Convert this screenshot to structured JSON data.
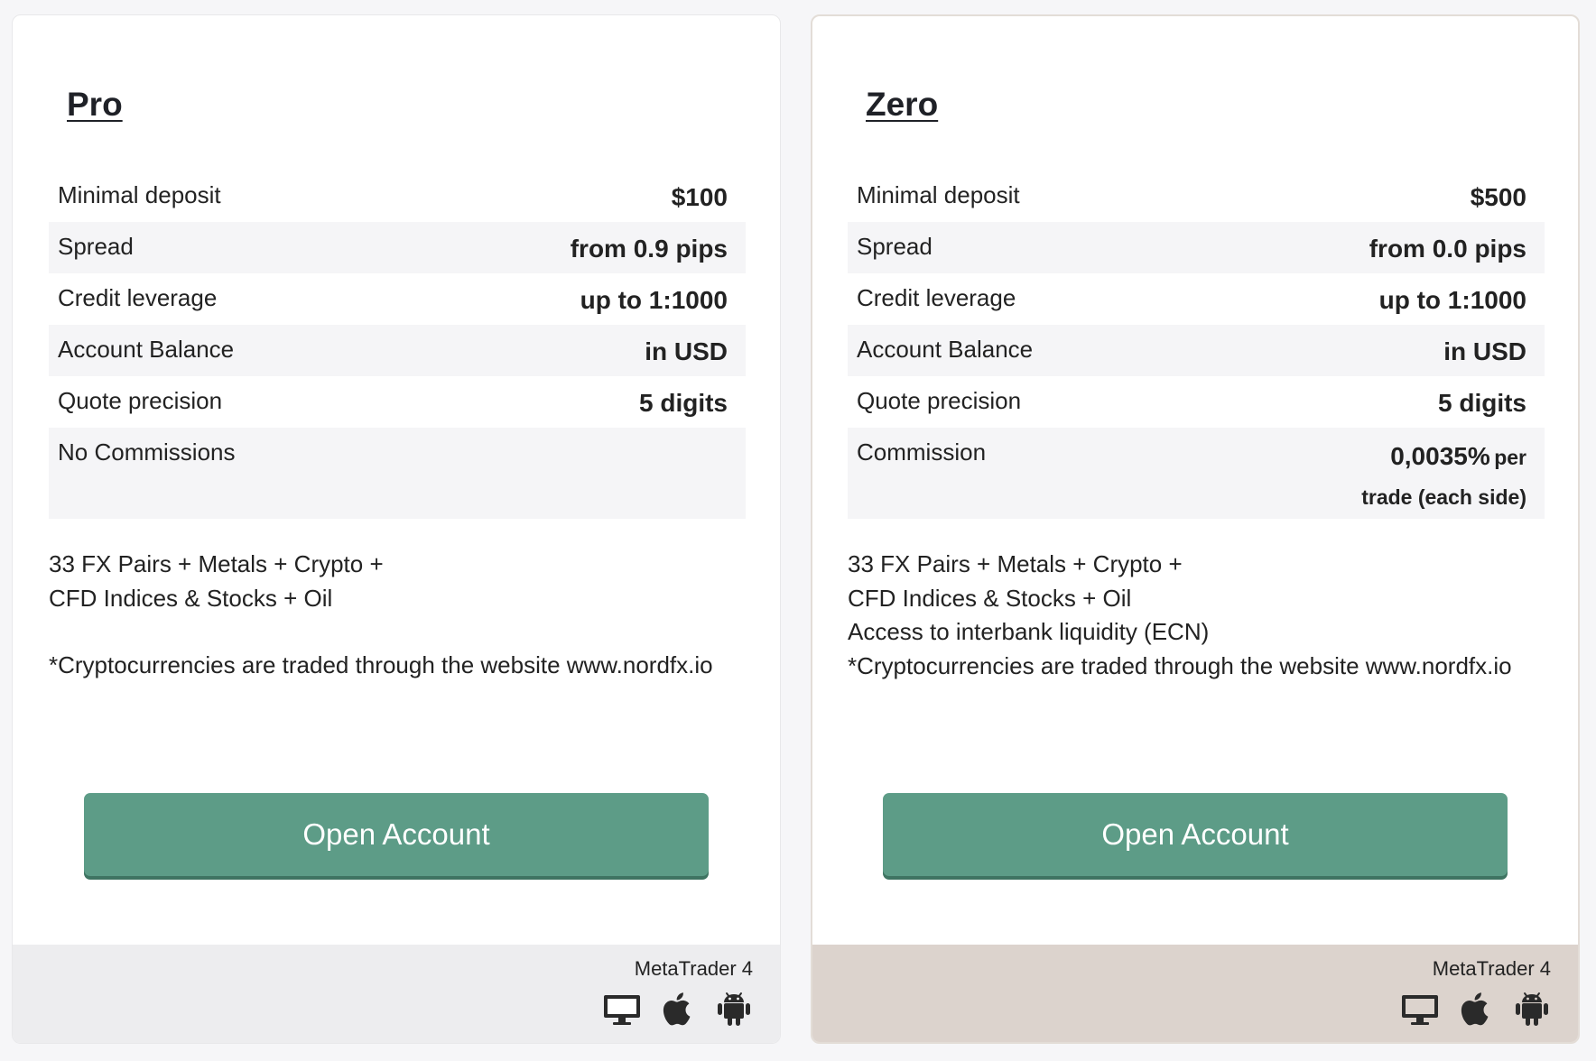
{
  "cards": [
    {
      "title": "Pro",
      "specs": [
        {
          "label": "Minimal deposit",
          "value": "$100"
        },
        {
          "label": "Spread",
          "value": "from 0.9 pips"
        },
        {
          "label": "Credit leverage",
          "value": "up to 1:1000"
        },
        {
          "label": "Account Balance",
          "value": "in USD"
        },
        {
          "label": "Quote precision",
          "value": "5 digits"
        },
        {
          "label": "No Commissions",
          "value": ""
        }
      ],
      "features": [
        "33 FX Pairs + Metals + Crypto +",
        "CFD Indices & Stocks + Oil",
        "",
        "*Cryptocurrencies are traded through the website www.nordfx.io"
      ],
      "button_label": "Open Account",
      "platform": "MetaTrader 4",
      "platform_icons": [
        "desktop-icon",
        "apple-icon",
        "android-icon"
      ],
      "footer_color": "#ededef"
    },
    {
      "title": "Zero",
      "specs": [
        {
          "label": "Minimal deposit",
          "value": "$500"
        },
        {
          "label": "Spread",
          "value": "from 0.0 pips"
        },
        {
          "label": "Credit leverage",
          "value": "up to 1:1000"
        },
        {
          "label": "Account Balance",
          "value": "in USD"
        },
        {
          "label": "Quote precision",
          "value": "5 digits"
        },
        {
          "label": "Commission",
          "value_main": "0,0035%",
          "value_suffix": "per",
          "value_line2": "trade (each side)"
        }
      ],
      "features": [
        "33 FX Pairs + Metals + Crypto +",
        "CFD Indices & Stocks + Oil",
        "Access to interbank liquidity (ECN)",
        "*Cryptocurrencies are traded through the website www.nordfx.io"
      ],
      "button_label": "Open Account",
      "platform": "MetaTrader 4",
      "platform_icons": [
        "desktop-icon",
        "apple-icon",
        "android-icon"
      ],
      "footer_color": "#dcd3cd"
    }
  ],
  "colors": {
    "button": "#5d9c87",
    "button_shadow": "#3f7462",
    "page_background": "#f6f6f8",
    "row_shade": "#f5f5f7"
  }
}
